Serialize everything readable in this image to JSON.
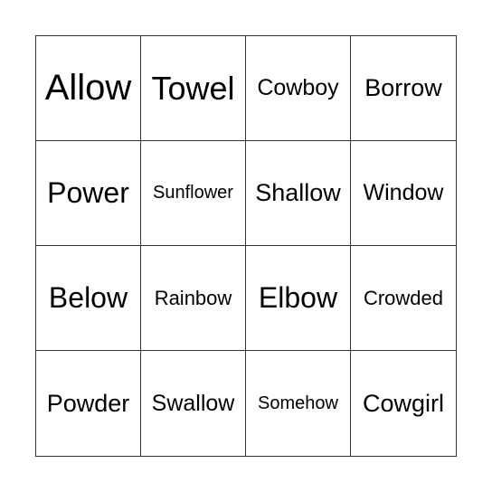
{
  "board": {
    "cells": [
      "Allow",
      "Towel",
      "Cowboy",
      "Borrow",
      "Power",
      "Sunflower",
      "Shallow",
      "Window",
      "Below",
      "Rainbow",
      "Elbow",
      "Crowded",
      "Powder",
      "Swallow",
      "Somehow",
      "Cowgirl"
    ]
  }
}
